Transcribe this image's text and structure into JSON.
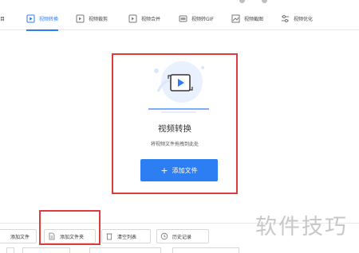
{
  "toolbar": {
    "cut_left_label": "目",
    "tabs": [
      {
        "label": "视频转换",
        "icon": "video-convert-icon",
        "active": true
      },
      {
        "label": "视频裁剪",
        "icon": "video-crop-icon",
        "active": false
      },
      {
        "label": "视频合并",
        "icon": "video-merge-icon",
        "active": false
      },
      {
        "label": "视频转GIF",
        "icon": "video-gif-icon",
        "active": false
      },
      {
        "label": "视频截图",
        "icon": "video-screenshot-icon",
        "active": false
      },
      {
        "label": "视频优化",
        "icon": "video-optimize-icon",
        "active": false
      }
    ]
  },
  "dropzone": {
    "title": "视频转换",
    "subtitle": "将视频文件拖拽到此处",
    "add_button": {
      "plus": "+",
      "label": "添加文件"
    }
  },
  "bottom_toolbar": {
    "buttons": [
      {
        "label": "添加文件",
        "icon": "add-file-icon"
      },
      {
        "label": "添加文件夹",
        "icon": "add-folder-icon"
      },
      {
        "label": "清空列表",
        "icon": "clear-list-icon"
      },
      {
        "label": "历史记录",
        "icon": "history-icon"
      }
    ]
  },
  "watermark": "软件技巧",
  "colors": {
    "accent": "#2d7ef2",
    "highlight_box": "#e03b3b",
    "watermark": "#c8c8c8"
  }
}
